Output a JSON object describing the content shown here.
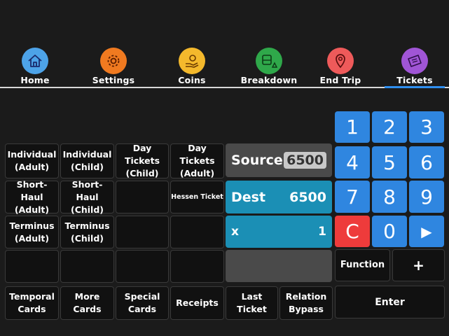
{
  "nav": {
    "items": [
      {
        "label": "Home",
        "icon": "home-icon",
        "color": "#4da3e8"
      },
      {
        "label": "Settings",
        "icon": "gear-icon",
        "color": "#f07a20"
      },
      {
        "label": "Coins",
        "icon": "coins-hand-icon",
        "color": "#f4b92c"
      },
      {
        "label": "Breakdown",
        "icon": "bus-warning-icon",
        "color": "#2fa84a"
      },
      {
        "label": "End Trip",
        "icon": "map-pin-icon",
        "color": "#ee5a5a"
      },
      {
        "label": "Tickets",
        "icon": "ticket-icon",
        "color": "#a055d6"
      }
    ],
    "active": "Tickets",
    "active_color": "#2f8ff0"
  },
  "tickets": {
    "row1": [
      "Individual\n(Adult)",
      "Individual\n(Child)",
      "Day Tickets\n(Child)",
      "Day Tickets\n(Adult)"
    ],
    "row2": [
      "Short-Haul\n(Adult)",
      "Short-Haul\n(Child)",
      "",
      "Hessen Ticket"
    ],
    "row3": [
      "Terminus\n(Adult)",
      "Terminus\n(Child)",
      "",
      ""
    ],
    "row4": [
      "",
      "",
      "",
      ""
    ],
    "row5": [
      "Temporal\nCards",
      "More\nCards",
      "Special\nCards",
      "Receipts"
    ]
  },
  "display": {
    "source_label": "Source",
    "source_value": "6500",
    "dest_label": "Dest",
    "dest_value": "6500",
    "qty_label": "x",
    "qty_value": "1",
    "teal_color": "#1b8fb5"
  },
  "actions": {
    "last_ticket": "Last Ticket",
    "relation_bypass": "Relation\nBypass",
    "function": "Function",
    "plus": "+",
    "enter": "Enter"
  },
  "keypad": {
    "keys": [
      "1",
      "2",
      "3",
      "4",
      "5",
      "6",
      "7",
      "8",
      "9",
      "C",
      "0",
      "▶"
    ],
    "key_color": "#2f86e0",
    "clear_color": "#ee3b3b"
  }
}
